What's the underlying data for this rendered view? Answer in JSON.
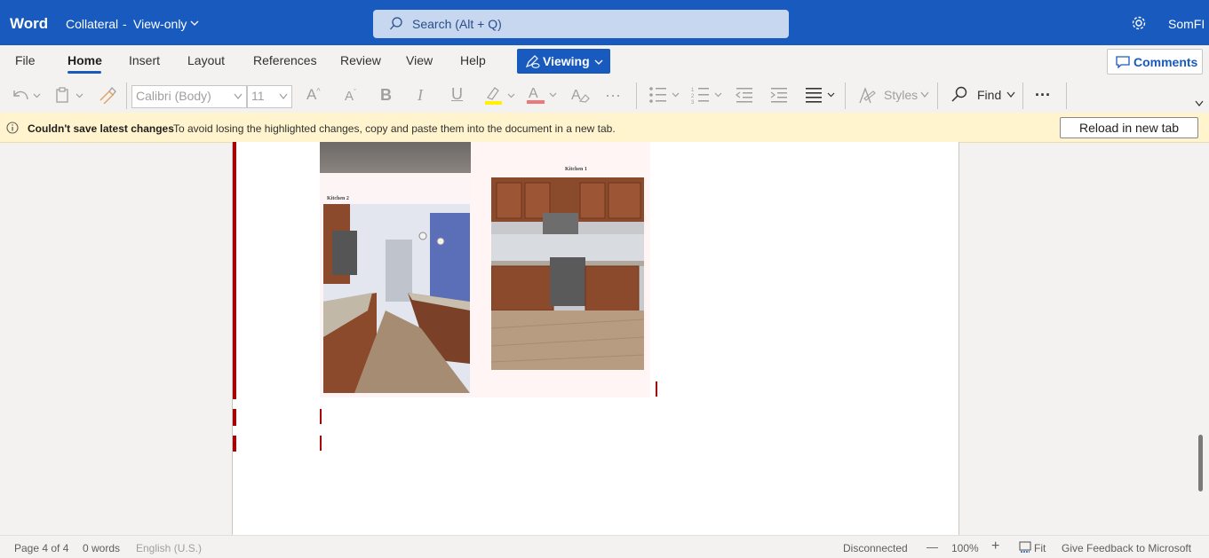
{
  "titlebar": {
    "app_name": "Word",
    "doc_title": "Collateral",
    "separator": "-",
    "mode": "View-only",
    "search_placeholder": "Search (Alt + Q)",
    "user": "SomFI"
  },
  "ribbon_tabs": [
    "File",
    "Home",
    "Insert",
    "Layout",
    "References",
    "Review",
    "View",
    "Help"
  ],
  "active_tab": "Home",
  "viewing_label": "Viewing",
  "comments_label": "Comments",
  "toolbar": {
    "font_name": "Calibri (Body)",
    "font_size": "11",
    "styles_label": "Styles",
    "find_label": "Find",
    "more": "···"
  },
  "warning": {
    "title": "Couldn't save latest changes",
    "text": "To avoid losing the highlighted changes, copy and paste them into the document in a new tab.",
    "button": "Reload in new tab"
  },
  "document": {
    "caption_kitchen1": "Kitchen 1",
    "caption_kitchen2": "Kitchen 2"
  },
  "statusbar": {
    "page": "Page 4 of 4",
    "words": "0 words",
    "language": "English (U.S.)",
    "connection": "Disconnected",
    "zoom_out": "—",
    "zoom": "100%",
    "zoom_in": "+",
    "fit": "Fit",
    "feedback": "Give Feedback to Microsoft"
  },
  "colors": {
    "brand": "#185abd",
    "warning_bg": "#fff4ce",
    "change_marker": "#a80000"
  }
}
